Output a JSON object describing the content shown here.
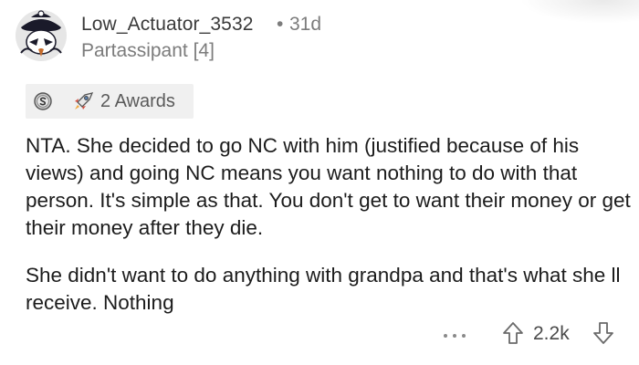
{
  "comment": {
    "username": "Low_Actuator_3532",
    "separator": "•",
    "age": "31d",
    "flair": "Partassipant [4]",
    "awards_label": "2 Awards",
    "paragraphs": [
      "NTA. She decided to go NC with him (justified because of his views) and going NC means you want nothing to do with that person. It's simple as that. You don't get to want their money or get their money after they die.",
      "She didn't want to do anything with grandpa and that's what she ll receive. Nothing"
    ],
    "score": "2.2k"
  },
  "icons": {
    "avatar": "snoo-avatar-icon",
    "award_1": "silver-award-icon",
    "award_2": "rocket-award-icon",
    "more": "more-options-icon",
    "upvote": "upvote-arrow-icon",
    "downvote": "downvote-arrow-icon"
  },
  "colors": {
    "text": "#1c1c1c",
    "meta": "#7c7c7c",
    "awards_bg": "#f0f0f0"
  }
}
